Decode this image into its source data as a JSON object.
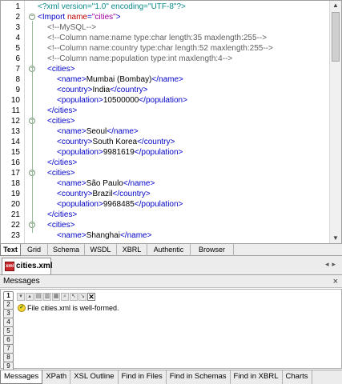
{
  "editor": {
    "lines": [
      {
        "n": "1",
        "indent": 0,
        "parts": [
          [
            "pi",
            "<?xml version=\"1.0\" encoding=\"UTF-8\"?>"
          ]
        ]
      },
      {
        "n": "2",
        "indent": 0,
        "fold": "minus",
        "parts": [
          [
            "tag",
            "<Import "
          ],
          [
            "att",
            "name"
          ],
          [
            "tag",
            "="
          ],
          [
            "val",
            "\"cities\""
          ],
          [
            "tag",
            ">"
          ]
        ]
      },
      {
        "n": "3",
        "indent": 1,
        "parts": [
          [
            "cmt",
            "<!--MySQL-->"
          ]
        ]
      },
      {
        "n": "4",
        "indent": 1,
        "parts": [
          [
            "cmt",
            "<!--Column name:name type:char length:35 maxlength:255-->"
          ]
        ]
      },
      {
        "n": "5",
        "indent": 1,
        "parts": [
          [
            "cmt",
            "<!--Column name:country type:char length:52 maxlength:255-->"
          ]
        ]
      },
      {
        "n": "6",
        "indent": 1,
        "parts": [
          [
            "cmt",
            "<!--Column name:population type:int maxlength:4-->"
          ]
        ]
      },
      {
        "n": "7",
        "indent": 1,
        "fold": "minus",
        "parts": [
          [
            "tag",
            "<cities>"
          ]
        ]
      },
      {
        "n": "8",
        "indent": 2,
        "parts": [
          [
            "tag",
            "<name>"
          ],
          [
            "txt",
            "Mumbai (Bombay)"
          ],
          [
            "tag",
            "</name>"
          ]
        ]
      },
      {
        "n": "9",
        "indent": 2,
        "parts": [
          [
            "tag",
            "<country>"
          ],
          [
            "txt",
            "India"
          ],
          [
            "tag",
            "</country>"
          ]
        ]
      },
      {
        "n": "10",
        "indent": 2,
        "parts": [
          [
            "tag",
            "<population>"
          ],
          [
            "txt",
            "10500000"
          ],
          [
            "tag",
            "</population>"
          ]
        ]
      },
      {
        "n": "11",
        "indent": 1,
        "parts": [
          [
            "tag",
            "</cities>"
          ]
        ]
      },
      {
        "n": "12",
        "indent": 1,
        "fold": "minus",
        "parts": [
          [
            "tag",
            "<cities>"
          ]
        ]
      },
      {
        "n": "13",
        "indent": 2,
        "parts": [
          [
            "tag",
            "<name>"
          ],
          [
            "txt",
            "Seoul"
          ],
          [
            "tag",
            "</name>"
          ]
        ]
      },
      {
        "n": "14",
        "indent": 2,
        "parts": [
          [
            "tag",
            "<country>"
          ],
          [
            "txt",
            "South Korea"
          ],
          [
            "tag",
            "</country>"
          ]
        ]
      },
      {
        "n": "15",
        "indent": 2,
        "parts": [
          [
            "tag",
            "<population>"
          ],
          [
            "txt",
            "9981619"
          ],
          [
            "tag",
            "</population>"
          ]
        ]
      },
      {
        "n": "16",
        "indent": 1,
        "parts": [
          [
            "tag",
            "</cities>"
          ]
        ]
      },
      {
        "n": "17",
        "indent": 1,
        "fold": "minus",
        "parts": [
          [
            "tag",
            "<cities>"
          ]
        ]
      },
      {
        "n": "18",
        "indent": 2,
        "parts": [
          [
            "tag",
            "<name>"
          ],
          [
            "txt",
            "São Paulo"
          ],
          [
            "tag",
            "</name>"
          ]
        ]
      },
      {
        "n": "19",
        "indent": 2,
        "parts": [
          [
            "tag",
            "<country>"
          ],
          [
            "txt",
            "Brazil"
          ],
          [
            "tag",
            "</country>"
          ]
        ]
      },
      {
        "n": "20",
        "indent": 2,
        "parts": [
          [
            "tag",
            "<population>"
          ],
          [
            "txt",
            "9968485"
          ],
          [
            "tag",
            "</population>"
          ]
        ]
      },
      {
        "n": "21",
        "indent": 1,
        "parts": [
          [
            "tag",
            "</cities>"
          ]
        ]
      },
      {
        "n": "22",
        "indent": 1,
        "fold": "minus",
        "parts": [
          [
            "tag",
            "<cities>"
          ]
        ]
      },
      {
        "n": "23",
        "indent": 2,
        "parts": [
          [
            "tag",
            "<name>"
          ],
          [
            "txt",
            "Shanghai"
          ],
          [
            "tag",
            "</name>"
          ]
        ]
      }
    ]
  },
  "view_tabs": [
    "Text",
    "Grid",
    "Schema",
    "WSDL",
    "XBRL",
    "Authentic",
    "Browser"
  ],
  "view_tab_active": "Text",
  "file_tab": {
    "label": "cities.xml *",
    "icon": "xml-file-icon"
  },
  "messages": {
    "title": "Messages",
    "side_tabs": [
      "1",
      "2",
      "3",
      "4",
      "5",
      "6",
      "7",
      "8",
      "9"
    ],
    "result": "File cities.xml is well-formed.",
    "result_icon": "check-icon"
  },
  "bottom_tabs": [
    "Messages",
    "XPath",
    "XSL Outline",
    "Find in Files",
    "Find in Schemas",
    "Find in XBRL",
    "Charts"
  ],
  "bottom_tab_active": "Messages",
  "colors": {
    "tag": "#0000c8",
    "attribute": "#c00000",
    "value": "#a000a0",
    "comment": "#606060",
    "pi": "#0a8a8a"
  }
}
